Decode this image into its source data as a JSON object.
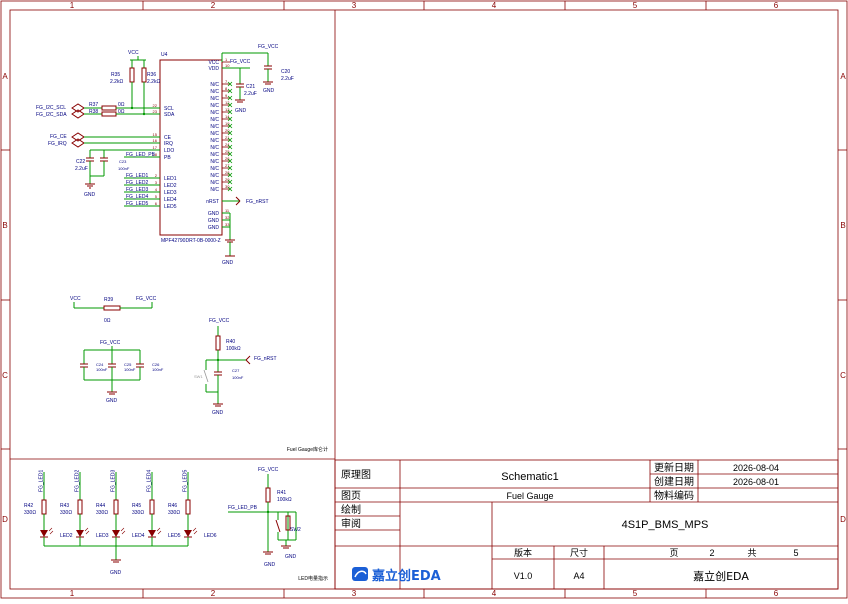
{
  "frame": {
    "col_labels": [
      "1",
      "2",
      "3",
      "4",
      "5",
      "6"
    ],
    "row_labels": [
      "A",
      "B",
      "C",
      "D"
    ]
  },
  "title_block": {
    "label_schematic": "原理图",
    "schematic_name": "Schematic1",
    "label_updated": "更新日期",
    "updated_date": "2026-08-04",
    "label_created": "创建日期",
    "created_date": "2026-08-01",
    "label_page": "图页",
    "page_name": "Fuel Gauge",
    "label_part_no": "物料编码",
    "label_drawn": "绘制",
    "label_reviewed": "审阅",
    "project_name": "4S1P_BMS_MPS",
    "label_version": "版本",
    "label_size": "尺寸",
    "label_page_no": "页",
    "page_number": "2",
    "label_total": "共",
    "total_pages": "5",
    "version": "V1.0",
    "size": "A4",
    "company": "嘉立创EDA",
    "logo_text": "嘉立创EDA"
  },
  "blocks": {
    "fuel_gauge_title": "Fuel Gauge库仑计",
    "led_title": "LED电量指示"
  },
  "u4": {
    "ref": "U4",
    "part": "MPF42790DRT-0B-0000-Z",
    "left_pins": [
      {
        "num": "22",
        "name": "SCL"
      },
      {
        "num": "23",
        "name": "SDA"
      },
      {
        "num": "15",
        "name": "CE"
      },
      {
        "num": "16",
        "name": "IRQ"
      },
      {
        "num": "17",
        "name": "LDO"
      },
      {
        "num": "18",
        "name": "PB"
      },
      {
        "num": "2",
        "name": "LED1"
      },
      {
        "num": "3",
        "name": "LED2"
      },
      {
        "num": "4",
        "name": "LED3"
      },
      {
        "num": "5",
        "name": "LED4"
      },
      {
        "num": "6",
        "name": "LED5"
      }
    ],
    "right_pins": [
      {
        "num": "1",
        "name": "VCC"
      },
      {
        "num": "10",
        "name": "VDD"
      },
      {
        "num": "7",
        "name": "N/C"
      },
      {
        "num": "8",
        "name": "N/C"
      },
      {
        "num": "9",
        "name": "N/C"
      },
      {
        "num": "12",
        "name": "N/C"
      },
      {
        "num": "13",
        "name": "N/C"
      },
      {
        "num": "14",
        "name": "N/C"
      },
      {
        "num": "19",
        "name": "N/C"
      },
      {
        "num": "20",
        "name": "N/C"
      },
      {
        "num": "21",
        "name": "N/C"
      },
      {
        "num": "24",
        "name": "N/C"
      },
      {
        "num": "25",
        "name": "N/C"
      },
      {
        "num": "26",
        "name": "N/C"
      },
      {
        "num": "27",
        "name": "N/C"
      },
      {
        "num": "28",
        "name": "N/C"
      },
      {
        "num": "29",
        "name": "N/C"
      },
      {
        "num": "30",
        "name": "N/C"
      },
      {
        "num": "",
        "name": "nRST"
      },
      {
        "num": "11",
        "name": "GND"
      },
      {
        "num": "32",
        "name": "GND"
      },
      {
        "num": "33",
        "name": "GND"
      }
    ]
  },
  "nets": {
    "vcc": "VCC",
    "fg_vcc": "FG_VCC",
    "gnd": "GND",
    "fg_i2c_scl": "FG_I2C_SCL",
    "fg_i2c_sda": "FG_I2C_SDA",
    "fg_ce": "FG_CE",
    "fg_irq": "FG_IRQ",
    "fg_led_pb": "FG_LED_PB",
    "fg_nrst": "FG_nRST",
    "fg_led": [
      "FG_LED1",
      "FG_LED2",
      "FG_LED3",
      "FG_LED4",
      "FG_LED5"
    ]
  },
  "components": {
    "r35": {
      "ref": "R35",
      "val": "2.2kΩ"
    },
    "r36": {
      "ref": "R36",
      "val": "2.2kΩ"
    },
    "r37": {
      "ref": "R37",
      "val": "0Ω"
    },
    "r38": {
      "ref": "R38",
      "val": "0Ω"
    },
    "r39": {
      "ref": "R39",
      "val": "0Ω"
    },
    "r40": {
      "ref": "R40",
      "val": "100kΩ"
    },
    "r41": {
      "ref": "R41",
      "val": "100kΩ"
    },
    "c20": {
      "ref": "C20",
      "val": "2.2uF"
    },
    "c21": {
      "ref": "C21",
      "val": "2.2uF"
    },
    "c22": {
      "ref": "C22",
      "val": "2.2uF"
    },
    "c23": {
      "ref": "C23",
      "val": "100nF"
    },
    "c24": {
      "ref": "C24",
      "val": "100nF"
    },
    "c25": {
      "ref": "C25",
      "val": "100nF"
    },
    "c26": {
      "ref": "C26",
      "val": "100nF"
    },
    "c27": {
      "ref": "C27",
      "val": "100nF"
    },
    "sw1": {
      "ref": "SW1"
    },
    "sw2": {
      "ref": "SW2"
    },
    "led_res": [
      {
        "ref": "R42",
        "val": "330Ω"
      },
      {
        "ref": "R43",
        "val": "330Ω"
      },
      {
        "ref": "R44",
        "val": "330Ω"
      },
      {
        "ref": "R45",
        "val": "330Ω"
      },
      {
        "ref": "R46",
        "val": "330Ω"
      }
    ],
    "leds": [
      "LED2",
      "LED3",
      "LED4",
      "LED5",
      "LED6"
    ]
  },
  "colors": {
    "wire": "#009900",
    "part": "#880000",
    "pin_text": "#000080",
    "net": "#000080",
    "border": "#880000",
    "text": "#000000",
    "logo": "#1b5fd6"
  }
}
